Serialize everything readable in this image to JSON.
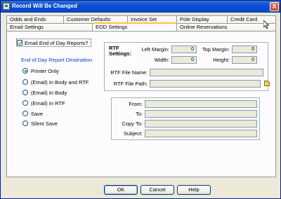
{
  "window": {
    "title": "Record Will Be Changed",
    "close_glyph": "X"
  },
  "tabs_row1": [
    "Odds and Ends",
    "Customer Defaults",
    "Invoice Set",
    "Pole Display",
    "Credit Card"
  ],
  "tabs_row2": [
    "Email Settings",
    "EOD Settings",
    "Online Reservations"
  ],
  "active_tab": "EOD Settings",
  "eod": {
    "email_checkbox_label": "Email End of Day Reports?",
    "email_checked": true,
    "destination_heading": "End of Day Report Destination",
    "options": [
      "Printer Only",
      "(Email) In Body and RTF",
      "(Email) In Body",
      "(Email) In RTF",
      "Save",
      "Silent Save"
    ],
    "selected_option": "Printer Only"
  },
  "rtf": {
    "heading_line1": "RTF",
    "heading_line2": "Settings:",
    "left_margin_label": "Left Margin:",
    "left_margin_value": "0",
    "top_margin_label": "Top Margin:",
    "top_margin_value": "0",
    "width_label": "Width:",
    "width_value": "0",
    "height_label": "Height:",
    "height_value": "0",
    "file_name_label": "RTF File Name:",
    "file_name_value": "",
    "file_path_label": "RTF File Path:",
    "file_path_value": ""
  },
  "email": {
    "from_label": "From:",
    "to_label": "To:",
    "copy_to_label": "Copy To:",
    "subject_label": "Subject:",
    "from_value": "",
    "to_value": "",
    "copy_to_value": "",
    "subject_value": ""
  },
  "buttons": {
    "ok": "OK",
    "cancel": "Cancel",
    "help": "Help"
  },
  "icons": [
    "app-icon",
    "close-icon",
    "checkbox-icon",
    "folder-icon"
  ]
}
